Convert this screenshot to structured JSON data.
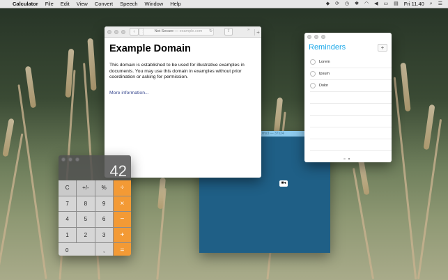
{
  "menubar": {
    "apple_icon": "apple-icon",
    "app_name": "Calculator",
    "menus": [
      "File",
      "Edit",
      "View",
      "Convert",
      "Speech",
      "Window",
      "Help"
    ],
    "clock": "Fri 11.40",
    "status_icons": [
      "dropbox-icon",
      "sync-icon",
      "timemachine-icon",
      "bluetooth-icon",
      "wifi-icon",
      "volume-icon",
      "battery-icon",
      "flag-icon",
      "search-icon",
      "list-icon"
    ]
  },
  "safari": {
    "address_prefix": "Not Secure — ",
    "address_host": "example.com",
    "page_title": "Example Domain",
    "paragraph": "This domain is established to be used for illustrative examples in documents. You may use this domain in examples without prior coordination or asking for permission.",
    "link": "More information..."
  },
  "reminders": {
    "title": "Reminders",
    "items": [
      "Lorem",
      "Ipsum",
      "Dolor"
    ]
  },
  "recorder": {
    "caption": "0ms3 — 37x24"
  },
  "calculator": {
    "display": "42",
    "keys": [
      [
        "C",
        "+/-",
        "%",
        "÷"
      ],
      [
        "7",
        "8",
        "9",
        "×"
      ],
      [
        "4",
        "5",
        "6",
        "−"
      ],
      [
        "1",
        "2",
        "3",
        "+"
      ],
      [
        "0",
        ",",
        "="
      ]
    ],
    "accent_color": "#f39a35"
  }
}
